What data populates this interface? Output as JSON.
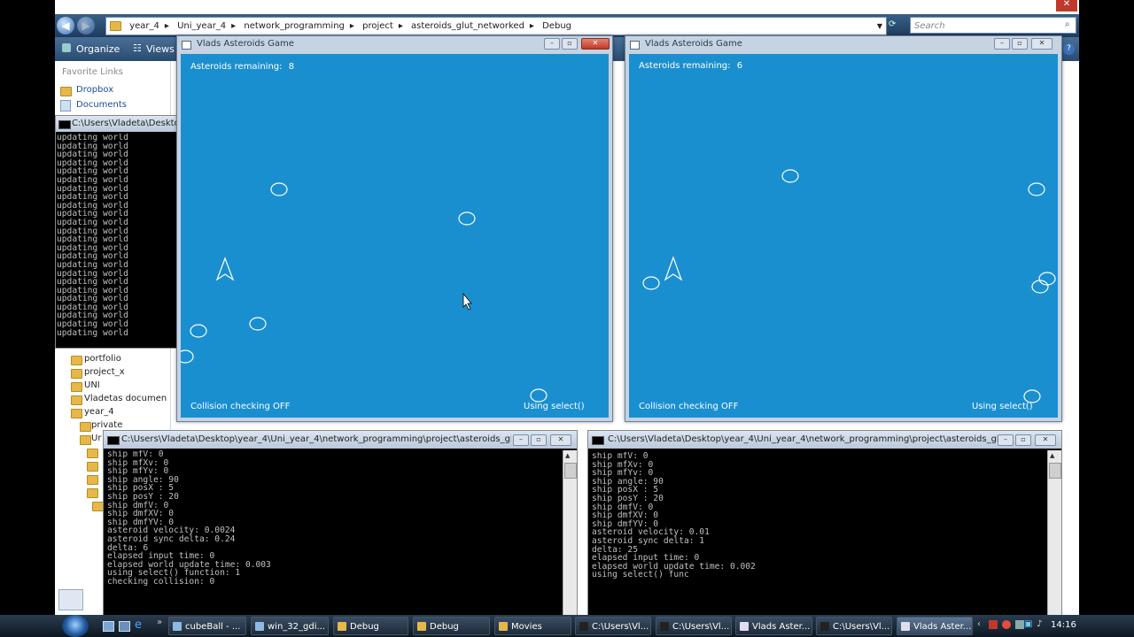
{
  "explorer": {
    "title_bar": {
      "min": "−",
      "max": "▫",
      "close": "✕"
    },
    "breadcrumbs": [
      "year_4",
      "Uni_year_4",
      "network_programming",
      "project",
      "asteroids_glut_networked",
      "Debug"
    ],
    "search_placeholder": "Search",
    "toolbar": {
      "organize": "Organize",
      "views": "Views"
    },
    "favorite_links_header": "Favorite Links",
    "favorites": [
      "Dropbox",
      "Documents"
    ],
    "folders": [
      "portfolio",
      "project_x",
      "UNI",
      "Vladetas documen",
      "year_4",
      "private",
      "Ur"
    ]
  },
  "world_console": {
    "title": "C:\\Users\\Vladeta\\Desktop\\y",
    "line": "updating world",
    "line_count": 24
  },
  "game_left": {
    "title": "Vlads Asteroids Game",
    "asteroids_label": "Asteroids remaining:",
    "asteroids_count": "8",
    "collision": "Collision checking OFF",
    "mode": "Using select()"
  },
  "game_right": {
    "title": "Vlads Asteroids Game",
    "asteroids_label": "Asteroids remaining:",
    "asteroids_count": "6",
    "collision": "Collision checking OFF",
    "mode": "Using select()"
  },
  "console_left": {
    "title": "C:\\Users\\Vladeta\\Desktop\\year_4\\Uni_year_4\\network_programming\\project\\asteroids_glut_networ...",
    "lines": [
      "ship mfV: 0",
      "ship mfXv: 0",
      "ship mfYv: 0",
      "ship angle: 90",
      "ship posX : 5",
      "ship posY : 20",
      "ship dmfV: 0",
      "ship dmfXV: 0",
      "ship dmfYV: 0",
      "asteroid velocity: 0.0024",
      "asteroid sync delta: 0.24",
      "delta: 6",
      "elapsed input time: 0",
      "elapsed world update time: 0.003",
      "using select() function: 1",
      "checking collision: 0"
    ]
  },
  "console_right": {
    "title": "C:\\Users\\Vladeta\\Desktop\\year_4\\Uni_year_4\\network_programming\\project\\asteroids_glut_networ...",
    "lines": [
      "ship mfV: 0",
      "ship mfXv: 0",
      "ship mfYv: 0",
      "ship angle: 90",
      "ship posX : 5",
      "ship posY : 20",
      "ship dmfV: 0",
      "ship dmfXV: 0",
      "ship dmfYV: 0",
      "asteroid velocity: 0.01",
      "asteroid sync delta: 1",
      "delta: 25",
      "elapsed input time: 0",
      "elapsed world update time: 0.002",
      "using select() func"
    ]
  },
  "taskbar": {
    "items": [
      "cubeBall - ...",
      "win_32_gdi...",
      "Debug",
      "Debug",
      "Movies",
      "C:\\Users\\Vl...",
      "C:\\Users\\Vl...",
      "Vlads Aster...",
      "C:\\Users\\Vl...",
      "Vlads Aster..."
    ],
    "clock": "14:16"
  },
  "colors": {
    "game_bg": "#1a8fd0",
    "console_bg": "#000000",
    "console_text": "#c0c0c0"
  }
}
